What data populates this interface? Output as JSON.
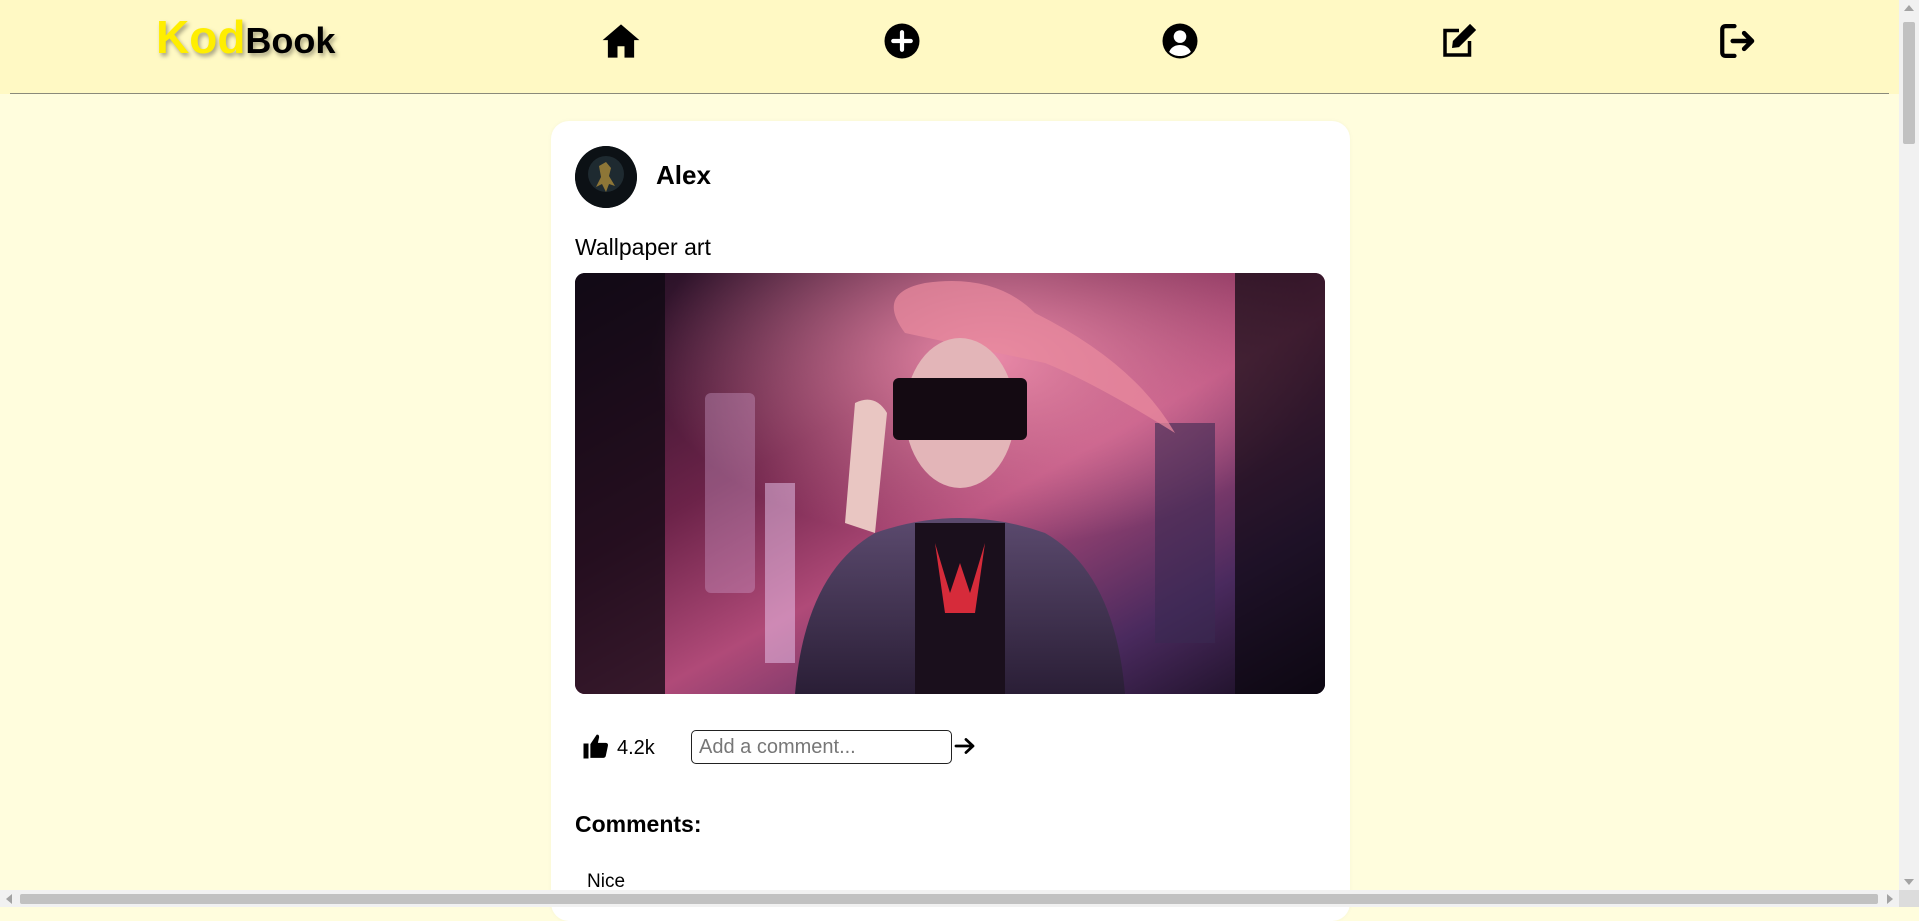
{
  "app": {
    "logo_part1": "Kod",
    "logo_part2": "Book"
  },
  "nav": {
    "items": [
      {
        "icon": "home-icon"
      },
      {
        "icon": "add-post-icon"
      },
      {
        "icon": "profile-icon"
      },
      {
        "icon": "edit-icon"
      },
      {
        "icon": "logout-icon"
      }
    ]
  },
  "post": {
    "author": "Alex",
    "caption": "Wallpaper art",
    "image_description_icon": "post-image",
    "likes": "4.2k",
    "comment_placeholder": "Add a comment...",
    "comment_value": "",
    "comments_heading": "Comments:",
    "comments": [
      "Nice"
    ]
  },
  "colors": {
    "background": "#fffddd",
    "header": "#fff9c4",
    "logo_accent": "#ffee00",
    "card": "#ffffff"
  }
}
